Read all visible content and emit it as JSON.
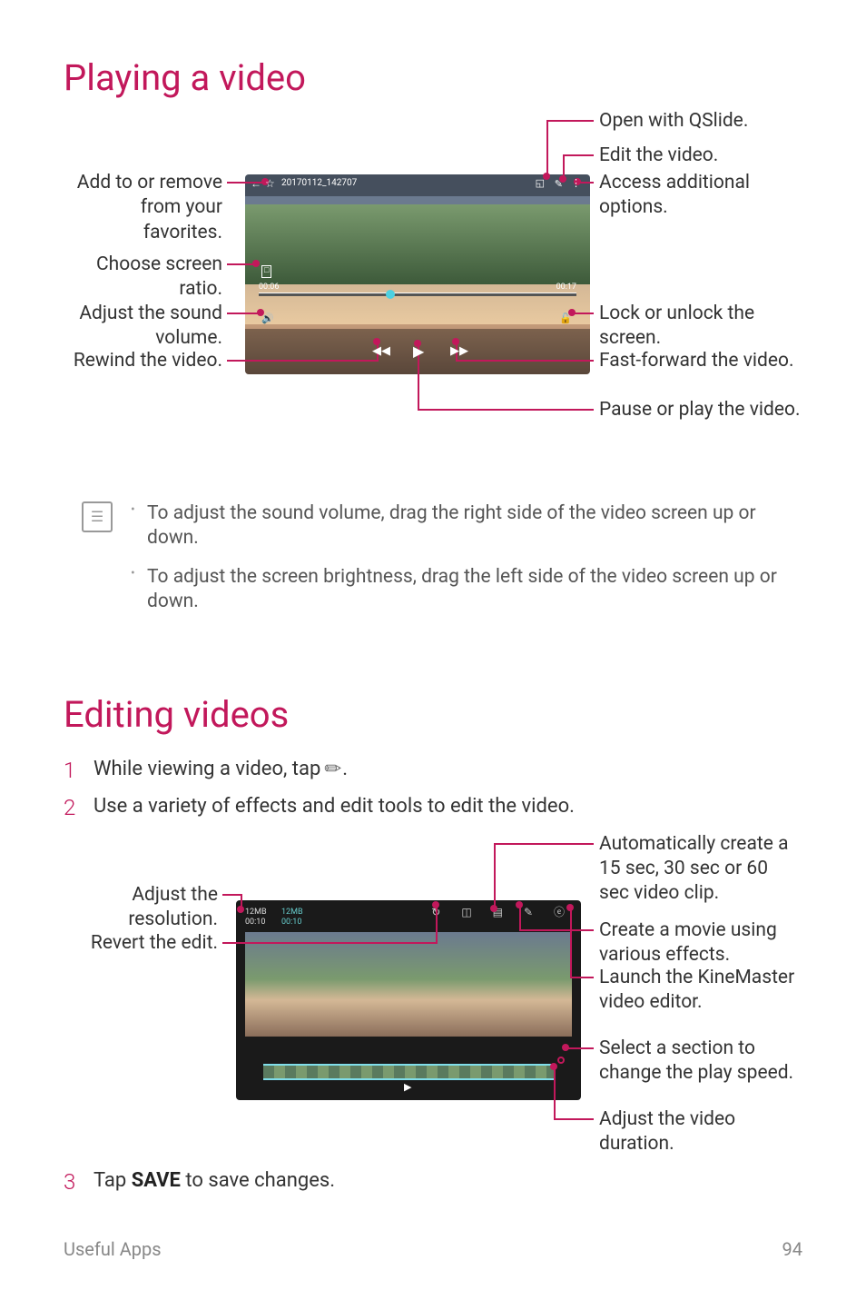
{
  "title1": "Playing a video",
  "fig1": {
    "filename": "20170112_142707",
    "time_cur": "00:06",
    "time_dur": "00:17",
    "left": {
      "fav": "Add to or remove from your favorites.",
      "ratio": "Choose screen ratio.",
      "vol": "Adjust the sound volume.",
      "rewind": "Rewind the video."
    },
    "right": {
      "qslide": "Open with QSlide.",
      "edit": "Edit the video.",
      "options": "Access additional options.",
      "lock": "Lock or unlock the screen.",
      "ff": "Fast-forward the video.",
      "pauseplay": "Pause or play the video."
    }
  },
  "note": {
    "b1": "To adjust the sound volume, drag the right side of the video screen up or down.",
    "b2": "To adjust the screen brightness, drag the left side of the video screen up or down."
  },
  "title2": "Editing videos",
  "steps": {
    "s1a": "While viewing a video, tap ",
    "s1b": ".",
    "s2": "Use a variety of effects and edit tools to edit the video.",
    "s3a": "Tap ",
    "s3b": "SAVE",
    "s3c": " to save changes."
  },
  "fig2": {
    "res1": "12MB\n00:10",
    "res2": "12MB\n00:10",
    "left": {
      "res": "Adjust the resolution.",
      "revert": "Revert the edit."
    },
    "right": {
      "auto": "Automatically create a 15 sec, 30 sec or 60 sec video clip.",
      "movie": "Create a movie using various effects.",
      "kine": "Launch the KineMaster video editor.",
      "speed": "Select a section to change the play speed.",
      "duration": "Adjust the video duration."
    }
  },
  "footer": {
    "section": "Useful Apps",
    "page": "94"
  }
}
